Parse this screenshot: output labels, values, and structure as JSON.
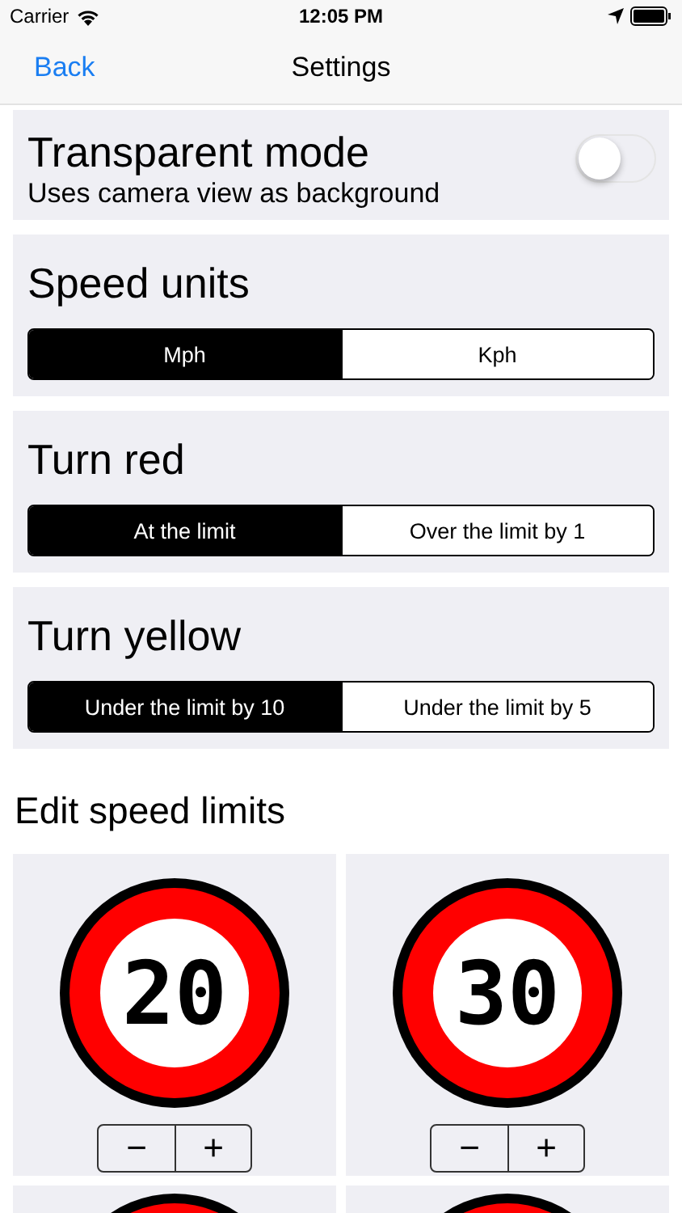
{
  "status_bar": {
    "carrier": "Carrier",
    "time": "12:05 PM"
  },
  "nav": {
    "back": "Back",
    "title": "Settings"
  },
  "transparent_mode": {
    "title": "Transparent mode",
    "subtitle": "Uses camera view as background",
    "on": false
  },
  "segments": [
    {
      "title": "Speed units",
      "options": [
        {
          "label": "Mph",
          "selected": true
        },
        {
          "label": "Kph",
          "selected": false
        }
      ]
    },
    {
      "title": "Turn red",
      "options": [
        {
          "label": "At the limit",
          "selected": true
        },
        {
          "label": "Over the limit by 1",
          "selected": false
        }
      ]
    },
    {
      "title": "Turn yellow",
      "options": [
        {
          "label": "Under the limit by 10",
          "selected": true
        },
        {
          "label": "Under the limit by 5",
          "selected": false
        }
      ]
    }
  ],
  "edit_heading": "Edit speed limits",
  "limits": [
    {
      "value": "20",
      "minus": "−",
      "plus": "+"
    },
    {
      "value": "30",
      "minus": "−",
      "plus": "+"
    }
  ],
  "partial_limits": [
    {
      "kind": "sign"
    },
    {
      "kind": "sign"
    }
  ]
}
